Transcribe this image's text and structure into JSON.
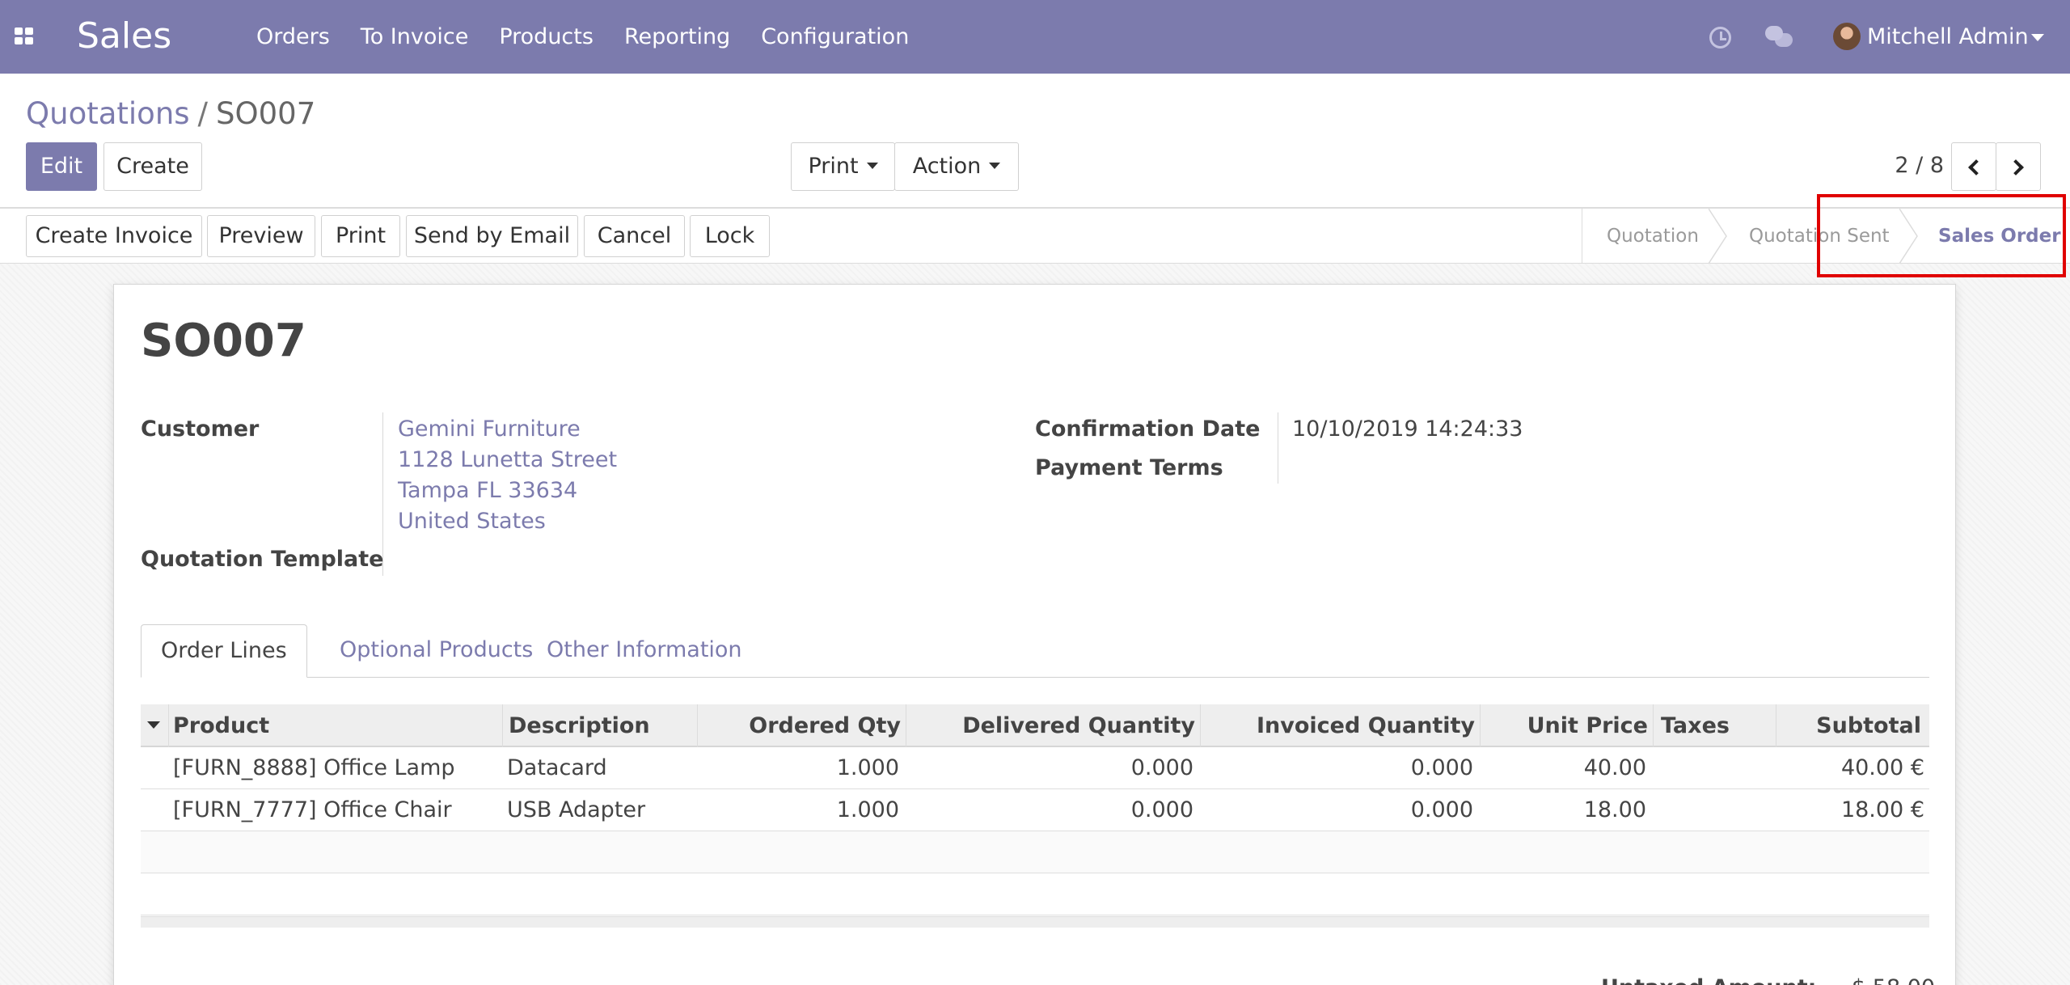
{
  "app": {
    "name": "Sales",
    "menu": [
      "Orders",
      "To Invoice",
      "Products",
      "Reporting",
      "Configuration"
    ],
    "user": "Mitchell Admin",
    "icons": {
      "apps": "apps-grid-icon",
      "activity": "clock-icon",
      "messages": "chat-icon"
    }
  },
  "breadcrumb": {
    "parent": "Quotations",
    "separator": "/",
    "current": "SO007"
  },
  "toolbar": {
    "edit": "Edit",
    "create": "Create",
    "print": "Print",
    "action": "Action",
    "pager": "2 / 8"
  },
  "statusbar": {
    "buttons": [
      "Create Invoice",
      "Preview",
      "Print",
      "Send by Email",
      "Cancel",
      "Lock"
    ],
    "stages": [
      "Quotation",
      "Quotation Sent",
      "Sales Order"
    ],
    "active_stage": "Sales Order"
  },
  "form": {
    "title": "SO007",
    "customer_label": "Customer",
    "customer_lines": [
      "Gemini Furniture",
      "1128 Lunetta Street",
      "Tampa FL 33634",
      "United States"
    ],
    "template_label": "Quotation Template",
    "confirmation_label": "Confirmation Date",
    "confirmation_value": "10/10/2019 14:24:33",
    "payment_terms_label": "Payment Terms"
  },
  "tabs": [
    "Order Lines",
    "Optional Products",
    "Other Information"
  ],
  "order_lines": {
    "columns": [
      "Product",
      "Description",
      "Ordered Qty",
      "Delivered Quantity",
      "Invoiced Quantity",
      "Unit Price",
      "Taxes",
      "Subtotal"
    ],
    "rows": [
      {
        "product": "[FURN_8888] Office Lamp",
        "description": "Datacard",
        "ordered": "1.000",
        "delivered": "0.000",
        "invoiced": "0.000",
        "unit_price": "40.00",
        "taxes": "",
        "subtotal": "40.00 €"
      },
      {
        "product": "[FURN_7777] Office Chair",
        "description": "USB Adapter",
        "ordered": "1.000",
        "delivered": "0.000",
        "invoiced": "0.000",
        "unit_price": "18.00",
        "taxes": "",
        "subtotal": "18.00 €"
      }
    ]
  },
  "totals": {
    "untaxed_label": "Untaxed Amount:",
    "untaxed_value": "$ 58.00"
  },
  "colors": {
    "brand": "#7c7bad",
    "highlight": "#e00000"
  }
}
